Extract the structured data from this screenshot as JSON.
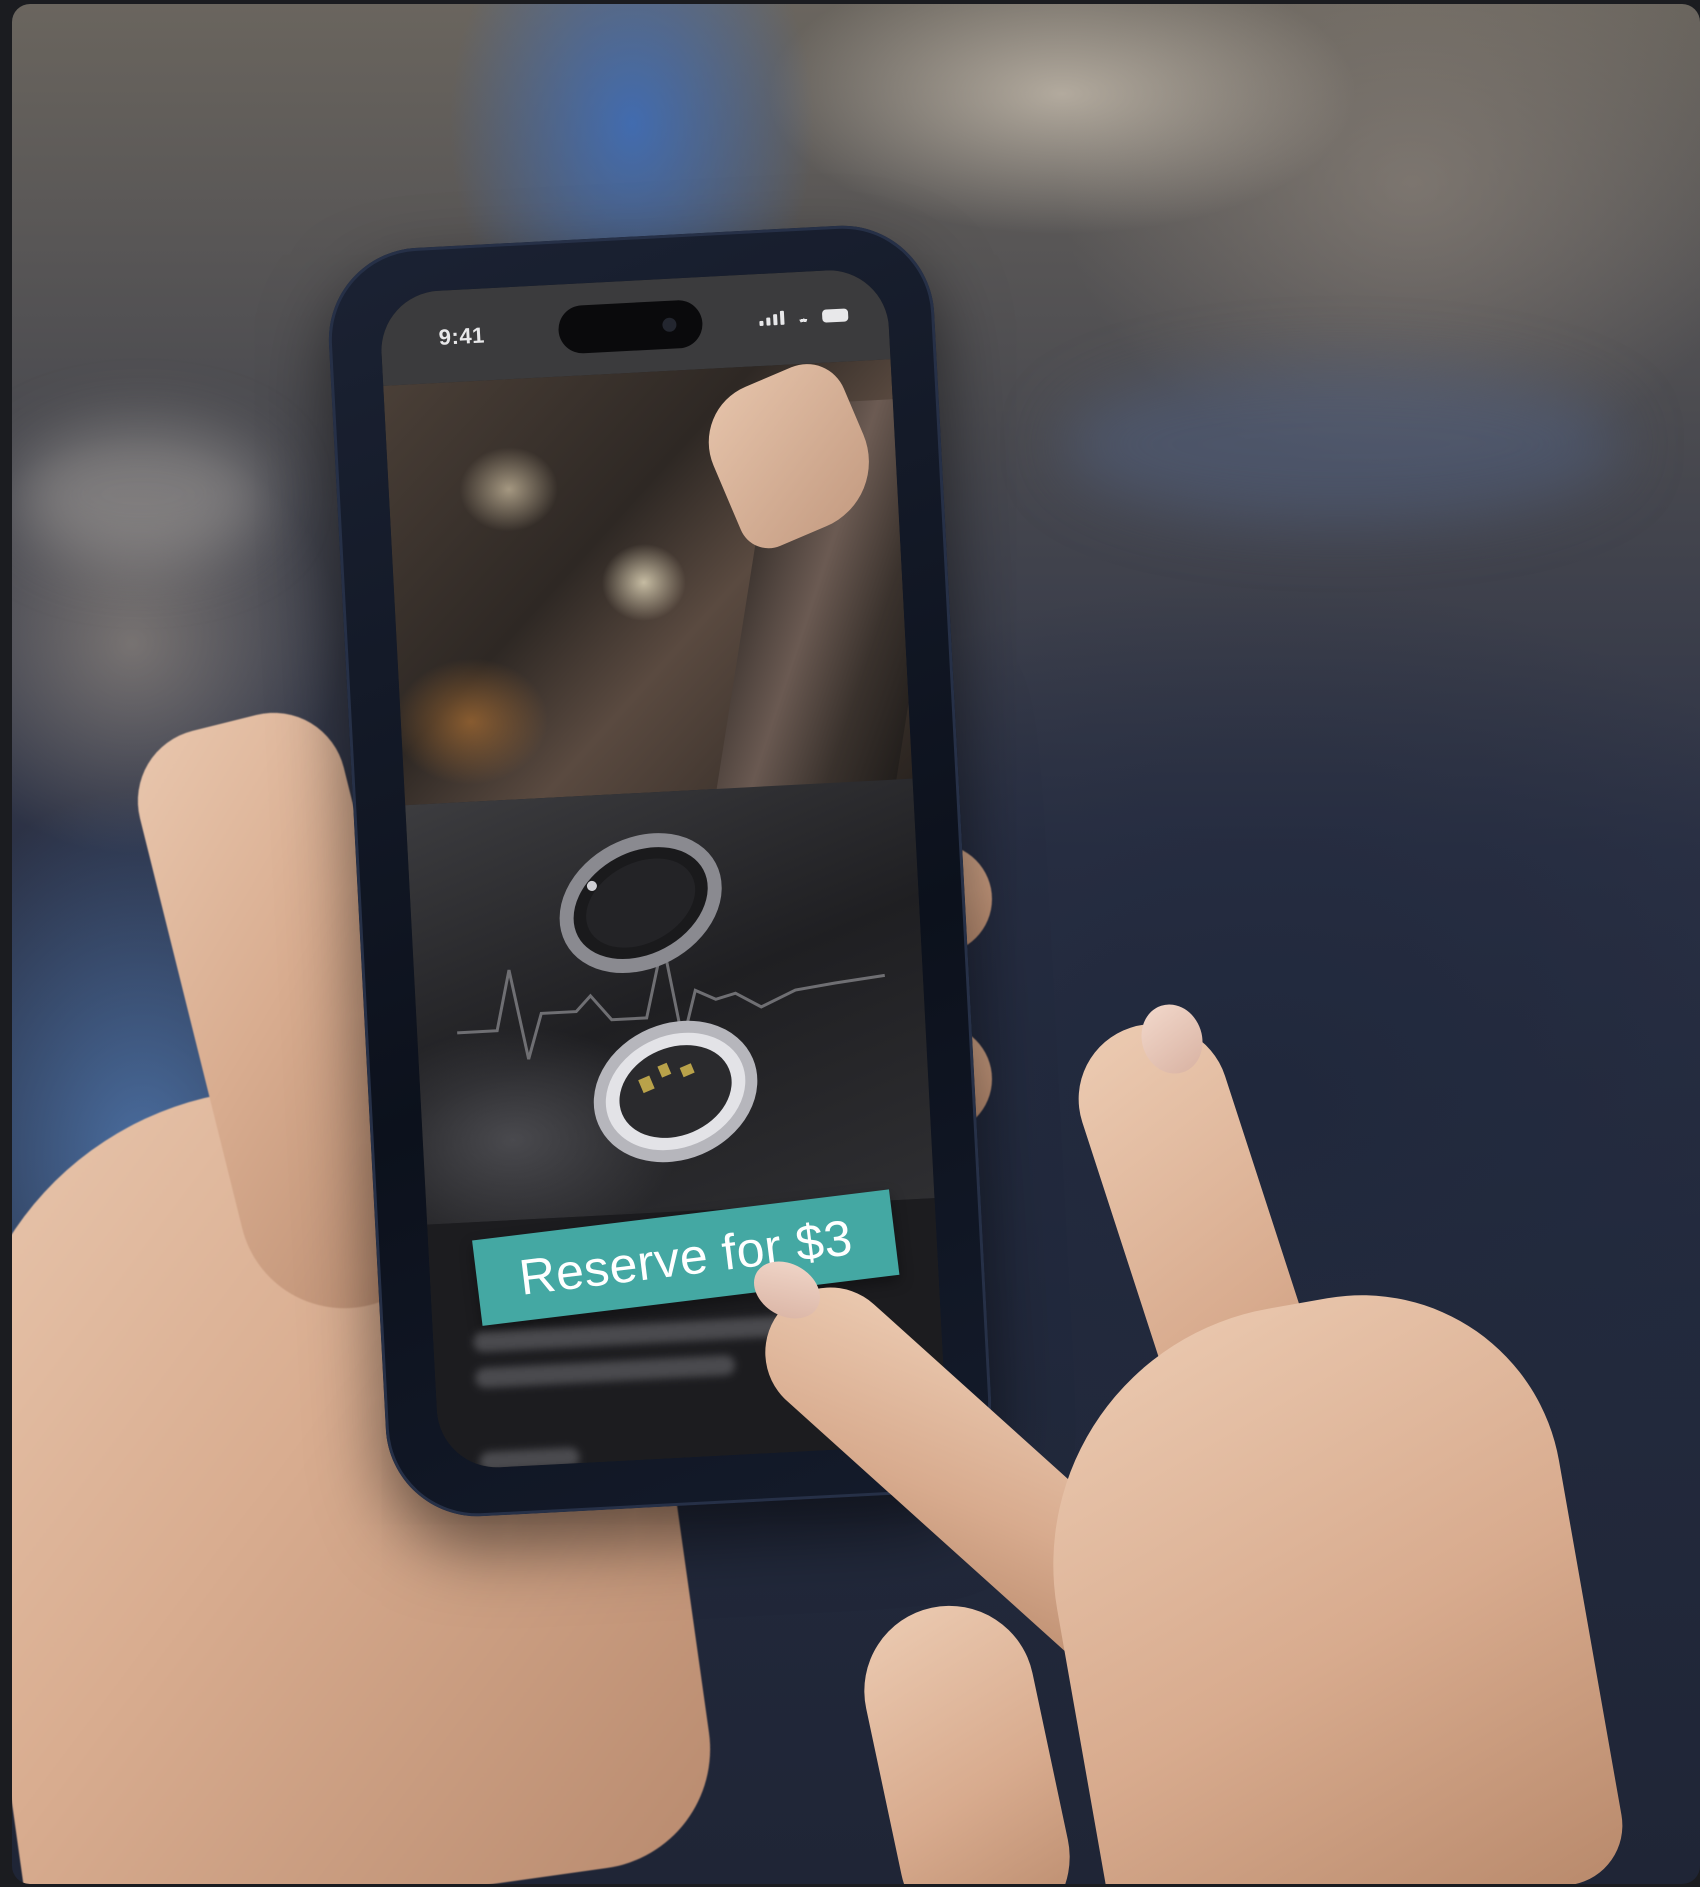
{
  "device": {
    "status_time": "9:41",
    "status_icons": [
      "signal-icon",
      "wifi-icon",
      "battery-icon"
    ]
  },
  "app": {
    "cta_label": "Reserve for $3",
    "accent_color": "#44a8a3"
  }
}
